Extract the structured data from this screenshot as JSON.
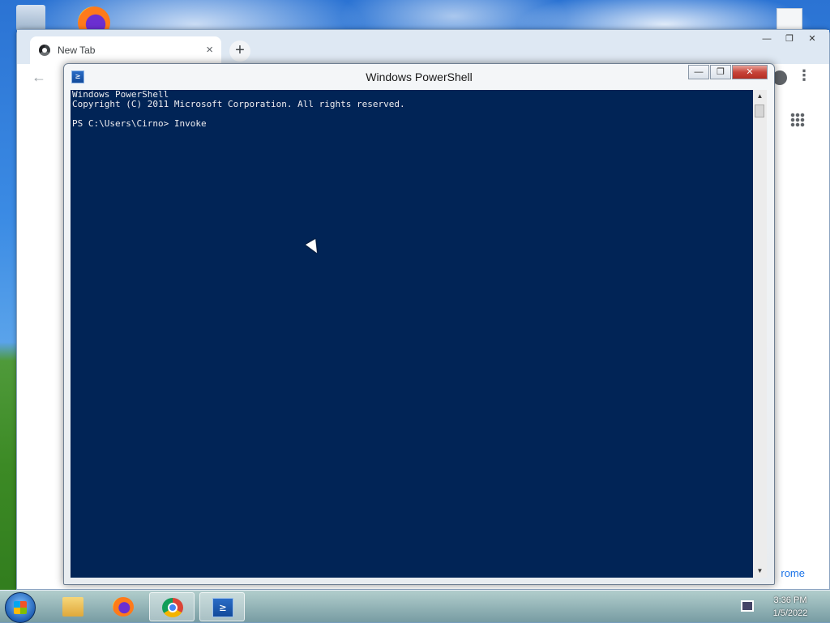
{
  "chrome": {
    "tab_title": "New Tab",
    "tab_close": "×",
    "new_tab": "+",
    "back": "←",
    "menu": "⋮",
    "win_min": "—",
    "win_max": "❐",
    "win_close": "✕",
    "customize_label": "rome"
  },
  "powershell": {
    "title": "Windows PowerShell",
    "icon_glyph": "≥",
    "min": "—",
    "max": "❐",
    "close": "✕",
    "lines": [
      "Windows PowerShell",
      "Copyright (C) 2011 Microsoft Corporation. All rights reserved.",
      "",
      "PS C:\\Users\\Cirno> Invoke"
    ],
    "scroll_up": "▲",
    "scroll_down": "▼"
  },
  "taskbar": {
    "time": "3:36 PM",
    "date": "1/5/2022",
    "active_app": "powershell"
  }
}
